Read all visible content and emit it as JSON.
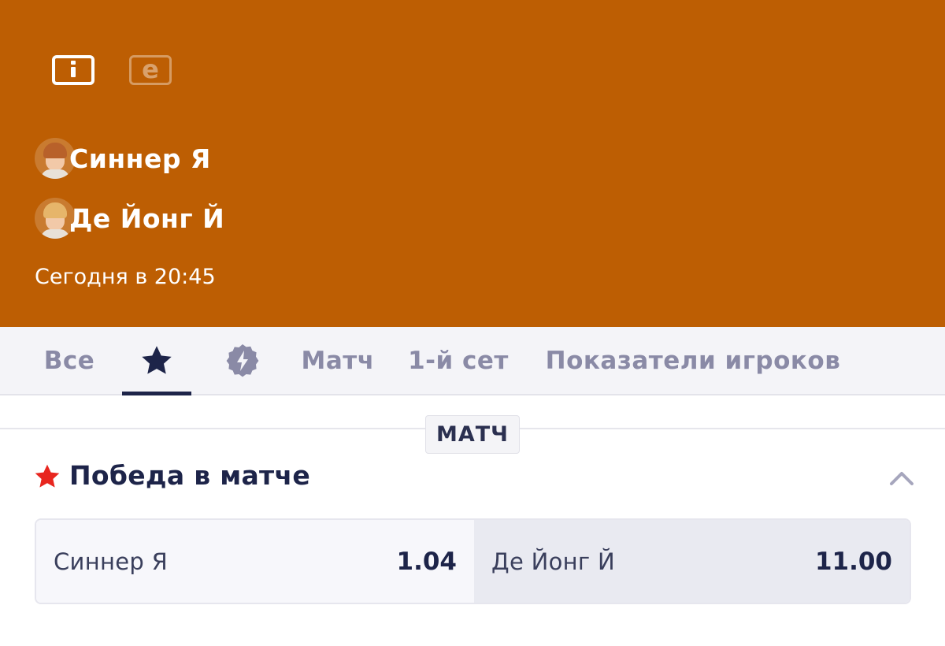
{
  "header": {
    "background_color": "#bd5e03",
    "icons": [
      "info-icon",
      "e-icon"
    ],
    "e_icon_glyph": "e",
    "players": [
      {
        "name": "Синнер Я"
      },
      {
        "name": "Де Йонг Й"
      }
    ],
    "start_time": "Сегодня в 20:45"
  },
  "tabs": {
    "active": "favorites",
    "items": [
      {
        "id": "all",
        "label": "Все"
      },
      {
        "id": "favorites",
        "icon": "star-icon"
      },
      {
        "id": "fast",
        "icon": "lightning-badge-icon"
      },
      {
        "id": "match",
        "label": "Матч"
      },
      {
        "id": "first-set",
        "label": "1-й сет"
      },
      {
        "id": "player-stats",
        "label": "Показатели игроков"
      }
    ]
  },
  "section": {
    "label": "МАТЧ"
  },
  "market": {
    "title": "Победа в матче",
    "icon": "star-icon",
    "icon_color": "#e8261f",
    "collapse_icon": "chevron-up-icon",
    "outcomes": [
      {
        "label": "Синнер Я",
        "odds": "1.04"
      },
      {
        "label": "Де Йонг Й",
        "odds": "11.00"
      }
    ]
  }
}
